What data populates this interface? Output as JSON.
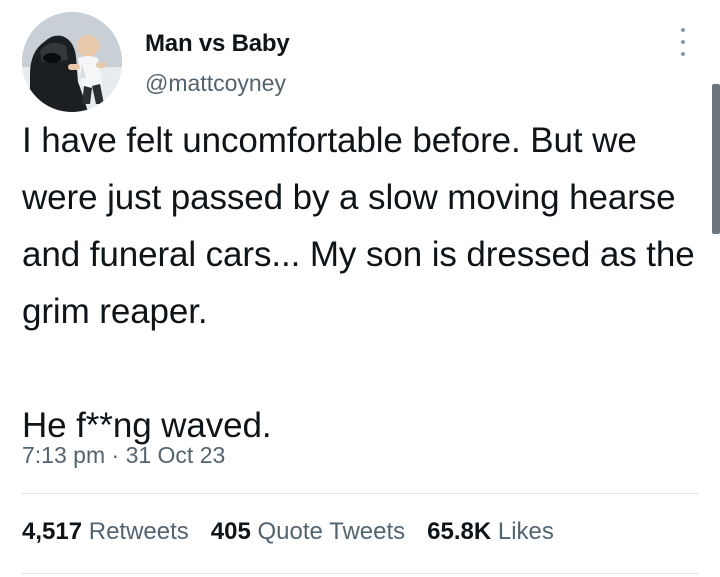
{
  "tweet": {
    "author": {
      "display_name": "Man vs Baby",
      "handle": "@mattcoyney",
      "avatar_icon": "avatar-vader-with-baby"
    },
    "text_paragraph_1": "I have felt uncomfortable before. But we were just passed by a slow moving hearse and funeral cars... My son is dressed as the grim reaper.",
    "text_paragraph_2": "He f**ng waved.",
    "time": "7:13 pm",
    "separator": "·",
    "date": "31 Oct 23",
    "stats": {
      "retweets_count": "4,517",
      "retweets_label": "Retweets",
      "quote_tweets_count": "405",
      "quote_tweets_label": "Quote Tweets",
      "likes_count": "65.8K",
      "likes_label": "Likes"
    }
  },
  "colors": {
    "text_primary": "#0f1419",
    "text_secondary": "#536471",
    "divider": "#e1e6ea",
    "icon_more": "#8b98a5"
  },
  "icons": {
    "more": "more-vertical-icon"
  }
}
